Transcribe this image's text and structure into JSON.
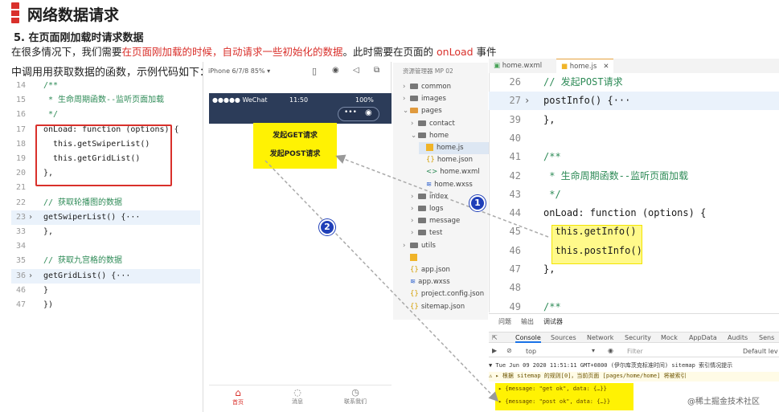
{
  "header": {
    "title": "网络数据请求",
    "section": "5. 在页面刚加载时请求数据",
    "intro_prefix": "在很多情况下，我们需要",
    "intro_red": "在页面刚加载的时候，自动请求一些初始化的数据",
    "intro_mid": "。此时需要在页面的 ",
    "intro_hook": "onLoad",
    "intro_suffix": " 事件",
    "sub": "中调用用获取数据的函数，示例代码如下："
  },
  "left_code": [
    {
      "n": "14",
      "code": "/**",
      "cls": "cm"
    },
    {
      "n": "15",
      "code": " * 生命周期函数--监听页面加载",
      "cls": "cm"
    },
    {
      "n": "16",
      "code": " */",
      "cls": "cm"
    },
    {
      "n": "17",
      "code": "onLoad: function (options) {",
      "cls": "pl"
    },
    {
      "n": "18",
      "code": "  this.getSwiperList()",
      "cls": "pl"
    },
    {
      "n": "19",
      "code": "  this.getGridList()",
      "cls": "pl"
    },
    {
      "n": "20",
      "code": "},",
      "cls": "pl"
    },
    {
      "n": "21",
      "code": "",
      "cls": "pl"
    },
    {
      "n": "22",
      "code": "// 获取轮播图的数据",
      "cls": "cm"
    },
    {
      "n": "23",
      "code": "getSwiperList() {···",
      "cls": "pl",
      "arrow": true,
      "hi": true
    },
    {
      "n": "33",
      "code": "},",
      "cls": "pl"
    },
    {
      "n": "34",
      "code": "",
      "cls": "pl"
    },
    {
      "n": "35",
      "code": "// 获取九宫格的数据",
      "cls": "cm"
    },
    {
      "n": "36",
      "code": "getGridList() {···",
      "cls": "pl",
      "arrow": true,
      "hi": true
    },
    {
      "n": "46",
      "code": "}",
      "cls": "pl"
    },
    {
      "n": "47",
      "code": "})",
      "cls": "pl"
    }
  ],
  "phone": {
    "toolbar": "iPhone 6/7/8 85% ▾",
    "status_left": "●●●●● WeChat",
    "status_time": "11:50",
    "status_right": "100%",
    "btn_get": "发起GET请求",
    "btn_post": "发起POST请求",
    "tabs": [
      "首页",
      "消息",
      "联系我们"
    ]
  },
  "tree": {
    "header": "资源管理器 MP 02",
    "items": [
      {
        "label": "common",
        "t": "folder",
        "indent": 0,
        "arrow": "›"
      },
      {
        "label": "images",
        "t": "folder",
        "indent": 0,
        "arrow": "›"
      },
      {
        "label": "pages",
        "t": "folder-open",
        "indent": 0,
        "arrow": "⌄"
      },
      {
        "label": "contact",
        "t": "folder",
        "indent": 1,
        "arrow": "›"
      },
      {
        "label": "home",
        "t": "folder",
        "indent": 1,
        "arrow": "⌄"
      },
      {
        "label": "home.js",
        "t": "js",
        "indent": 2,
        "sel": true
      },
      {
        "label": "home.json",
        "t": "json",
        "indent": 2
      },
      {
        "label": "home.wxml",
        "t": "xml",
        "indent": 2
      },
      {
        "label": "home.wxss",
        "t": "css",
        "indent": 2
      },
      {
        "label": "index",
        "t": "folder",
        "indent": 1,
        "arrow": "›"
      },
      {
        "label": "logs",
        "t": "folder",
        "indent": 1,
        "arrow": "›"
      },
      {
        "label": "message",
        "t": "folder",
        "indent": 1,
        "arrow": "›"
      },
      {
        "label": "test",
        "t": "folder",
        "indent": 1,
        "arrow": "›"
      },
      {
        "label": "utils",
        "t": "folder",
        "indent": 0,
        "arrow": "›"
      },
      {
        "label": "",
        "t": "js",
        "indent": 0
      },
      {
        "label": "app.json",
        "t": "json",
        "indent": 0
      },
      {
        "label": "app.wxss",
        "t": "css",
        "indent": 0
      },
      {
        "label": "project.config.json",
        "t": "json",
        "indent": 0
      },
      {
        "label": "sitemap.json",
        "t": "json",
        "indent": 0
      }
    ]
  },
  "editor": {
    "tab1": "home.wxml",
    "tab2": "home.js",
    "lines": [
      {
        "n": "26",
        "code": "// 发起POST请求",
        "cls": "cm"
      },
      {
        "n": "27",
        "code": "postInfo() {···",
        "cls": "pl",
        "arrow": true,
        "hi": true
      },
      {
        "n": "39",
        "code": "},",
        "cls": "pl"
      },
      {
        "n": "40",
        "code": "",
        "cls": "pl"
      },
      {
        "n": "41",
        "code": "/**",
        "cls": "cm"
      },
      {
        "n": "42",
        "code": " * 生命周期函数--监听页面加载",
        "cls": "cm"
      },
      {
        "n": "43",
        "code": " */",
        "cls": "cm"
      },
      {
        "n": "44",
        "code": "onLoad: function (options) {",
        "cls": "pl"
      },
      {
        "n": "45",
        "code": "  this.getInfo()",
        "cls": "pl"
      },
      {
        "n": "46",
        "code": "  this.postInfo()",
        "cls": "pl"
      },
      {
        "n": "47",
        "code": "},",
        "cls": "pl"
      },
      {
        "n": "48",
        "code": "",
        "cls": "pl"
      },
      {
        "n": "49",
        "code": "/**",
        "cls": "cm"
      }
    ]
  },
  "devtools": {
    "tabs1": [
      "问题",
      "输出",
      "调试器"
    ],
    "tabs2": [
      "Console",
      "Sources",
      "Network",
      "Security",
      "Mock",
      "AppData",
      "Audits",
      "Sens"
    ],
    "context": "top",
    "filter": "Filter",
    "levels": "Default lev",
    "log1": "▼ Tue Jun 09 2020 11:51:11 GMT+0800 (伊尔库茨克标准时间) sitemap 索引情况提示",
    "log2": "⚠ ▸ 根据 sitemap 的规则[0]，当前页面 [pages/home/home] 将被索引",
    "log3": "▸ {message: \"get ok\", data: {…}}",
    "log4": "▸ {message: \"post ok\", data: {…}}"
  },
  "badges": [
    "1",
    "2"
  ],
  "watermark": "@稀土掘金技术社区"
}
